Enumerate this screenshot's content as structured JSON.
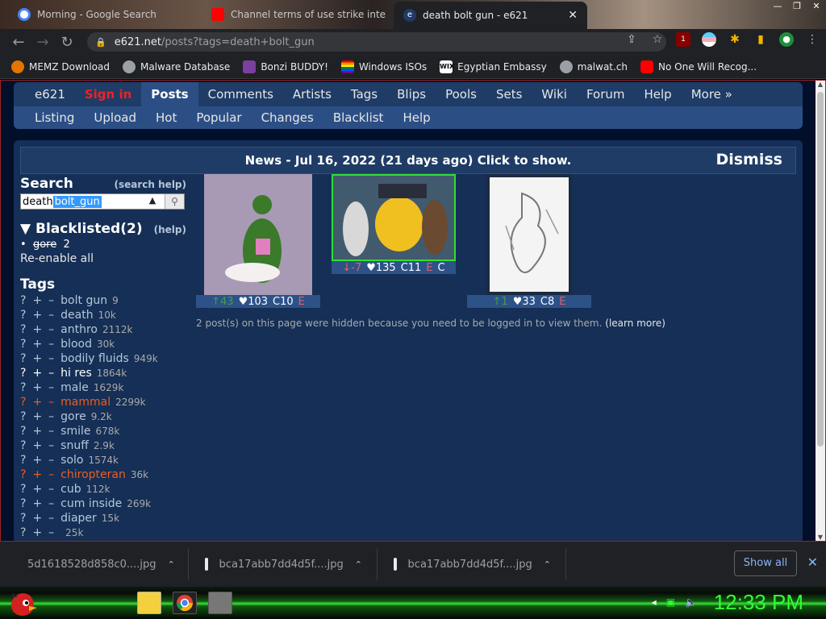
{
  "tabs": [
    {
      "title": "Morning - Google Search",
      "icon": "google-icon"
    },
    {
      "title": "Channel terms of use strike inte",
      "icon": "youtube-icon"
    },
    {
      "title": "death bolt gun - e621",
      "icon": "e621-icon",
      "active": true
    }
  ],
  "toolbar": {
    "url_domain": "e621.net",
    "url_path": "/posts?tags=death+bolt_gun",
    "ublock_count": "1"
  },
  "bookmarks": [
    {
      "label": "MEMZ Download",
      "color": "#e37400"
    },
    {
      "label": "Malware Database",
      "color": "#9aa0a6"
    },
    {
      "label": "Bonzi BUDDY!",
      "color": "#7b3fa0"
    },
    {
      "label": "Windows ISOs",
      "color": "#f4b400"
    },
    {
      "label": "Egyptian Embassy",
      "color": "#ffffff"
    },
    {
      "label": "malwat.ch",
      "color": "#9aa0a6"
    },
    {
      "label": "No One Will Recog...",
      "color": "#ff0000"
    }
  ],
  "mainnav": {
    "logo": "e621",
    "signin": "Sign in",
    "items": [
      "Posts",
      "Comments",
      "Artists",
      "Tags",
      "Blips",
      "Pools",
      "Sets",
      "Wiki",
      "Forum",
      "Help",
      "More »"
    ]
  },
  "subnav": [
    "Listing",
    "Upload",
    "Hot",
    "Popular",
    "Changes",
    "Blacklist",
    "Help"
  ],
  "news": {
    "text": "News - Jul 16, 2022 (21 days ago) Click to show.",
    "dismiss": "Dismiss"
  },
  "sidebar": {
    "search_title": "Search",
    "search_help": "(search help)",
    "search_value_plain": "death",
    "search_value_selected": " bolt_gun",
    "blacklisted_title": "▼ Blacklisted(2)",
    "blacklisted_help": "(help)",
    "blacklisted_items": [
      {
        "tag": "gore",
        "count": "2"
      }
    ],
    "reenable": "Re-enable all",
    "tags_title": "Tags",
    "tags": [
      {
        "name": "bolt gun",
        "count": "9",
        "style": "n"
      },
      {
        "name": "death",
        "count": "10k",
        "style": "n"
      },
      {
        "name": "anthro",
        "count": "2112k",
        "style": "n"
      },
      {
        "name": "blood",
        "count": "30k",
        "style": "n"
      },
      {
        "name": "bodily fluids",
        "count": "949k",
        "style": "n"
      },
      {
        "name": "hi res",
        "count": "1864k",
        "style": "b"
      },
      {
        "name": "male",
        "count": "1629k",
        "style": "n"
      },
      {
        "name": "mammal",
        "count": "2299k",
        "style": "r"
      },
      {
        "name": "gore",
        "count": "9.2k",
        "style": "n"
      },
      {
        "name": "smile",
        "count": "678k",
        "style": "n"
      },
      {
        "name": "snuff",
        "count": "2.9k",
        "style": "n"
      },
      {
        "name": "solo",
        "count": "1574k",
        "style": "n"
      },
      {
        "name": "chiropteran",
        "count": "36k",
        "style": "r"
      },
      {
        "name": "cub",
        "count": "112k",
        "style": "n"
      },
      {
        "name": "cum inside",
        "count": "269k",
        "style": "n"
      },
      {
        "name": "diaper",
        "count": "15k",
        "style": "n"
      },
      {
        "name": "",
        "count": "25k",
        "style": "n"
      }
    ]
  },
  "posts": [
    {
      "score": "↑43",
      "score_dir": "up",
      "favs": "♥103",
      "comments": "C10",
      "rating": "E"
    },
    {
      "score": "↓-7",
      "score_dir": "down",
      "favs": "♥135",
      "comments": "C11",
      "rating": "E",
      "extra": "C"
    },
    {
      "score": "↑1",
      "score_dir": "up",
      "favs": "♥33",
      "comments": "C8",
      "rating": "E"
    }
  ],
  "hidden_note": "2 post(s) on this page were hidden because you need to be logged in to view them.",
  "learn_more": "(learn more)",
  "downloads": [
    {
      "name": "5d1618528d858c0....jpg"
    },
    {
      "name": "bca17abb7dd4d5f....jpg"
    },
    {
      "name": "bca17abb7dd4d5f....jpg"
    }
  ],
  "show_all": "Show all",
  "clock": "12:33 PM"
}
